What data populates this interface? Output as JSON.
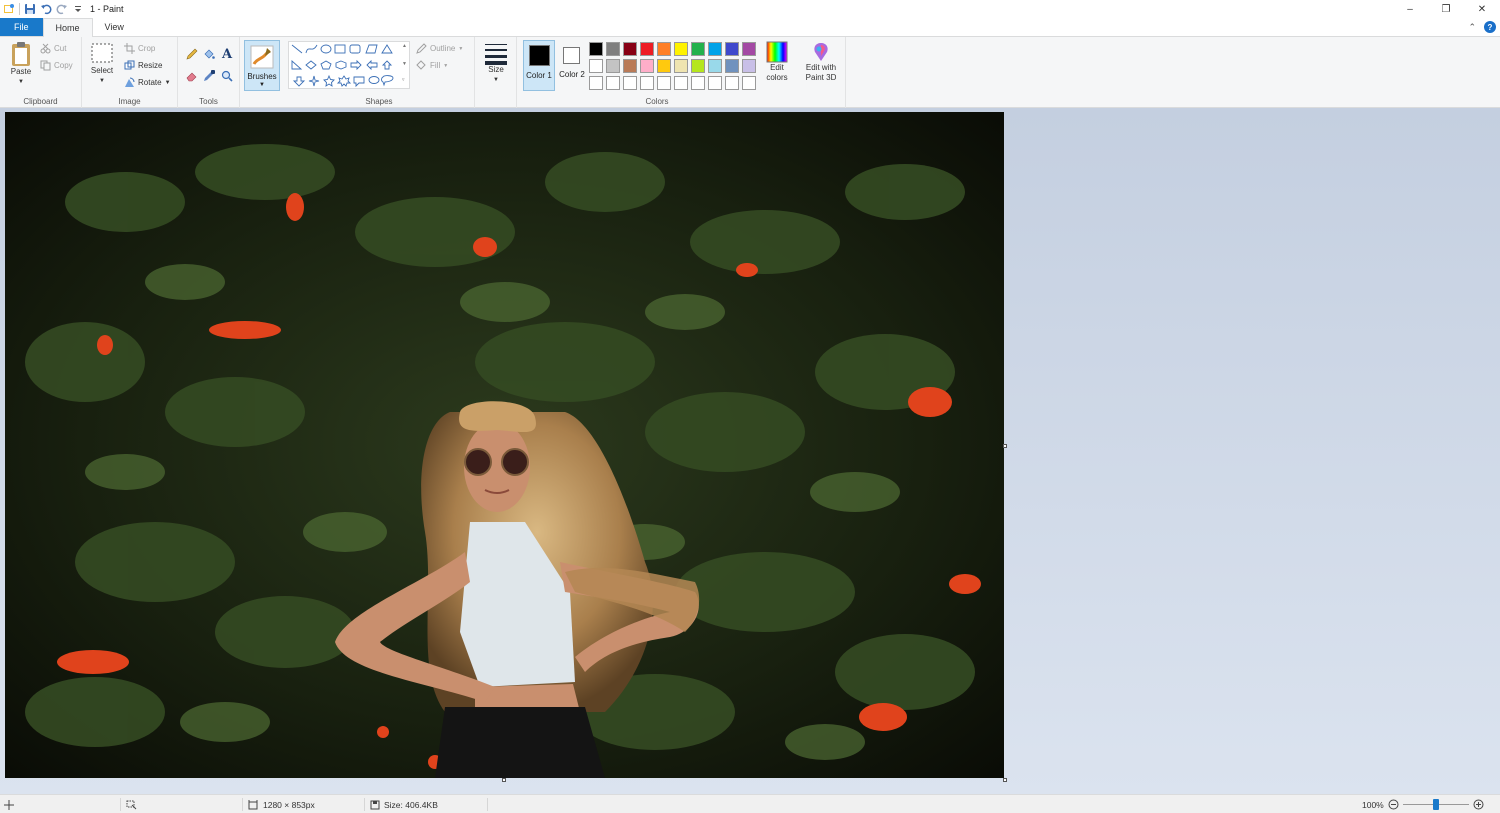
{
  "window": {
    "title": "1 - Paint",
    "controls": [
      "minimize-icon",
      "restore-icon",
      "close-icon"
    ]
  },
  "tabs": [
    {
      "label": "File"
    },
    {
      "label": "Home"
    },
    {
      "label": "View"
    }
  ],
  "ribbon": {
    "clipboard": {
      "label": "Clipboard",
      "paste": "Paste",
      "cut": "Cut",
      "copy": "Copy"
    },
    "image": {
      "label": "Image",
      "select": "Select",
      "crop": "Crop",
      "resize": "Resize",
      "rotate": "Rotate"
    },
    "tools": {
      "label": "Tools"
    },
    "brushes": {
      "label": "Brushes"
    },
    "shapes": {
      "label": "Shapes",
      "outline": "Outline",
      "fill": "Fill"
    },
    "size": {
      "label": "Size"
    },
    "colors": {
      "label": "Colors",
      "color1": "Color 1",
      "color2": "Color 2",
      "edit_colors": "Edit colors",
      "edit_paint3d": "Edit with Paint 3D",
      "palette_row1": [
        "#000000",
        "#7f7f7f",
        "#880015",
        "#ed1c24",
        "#ff7f27",
        "#fff200",
        "#22b14c",
        "#00a2e8",
        "#3f48cc",
        "#a349a4"
      ],
      "palette_row2": [
        "#ffffff",
        "#c3c3c3",
        "#b97a57",
        "#ffaec9",
        "#ffc90e",
        "#efe4b0",
        "#b5e61d",
        "#99d9ea",
        "#7092be",
        "#c8bfe7"
      ],
      "palette_row3": [
        "#ffffff",
        "#ffffff",
        "#ffffff",
        "#ffffff",
        "#ffffff",
        "#ffffff",
        "#ffffff",
        "#ffffff",
        "#ffffff",
        "#ffffff"
      ],
      "primary": "#000000",
      "secondary": "#ffffff"
    }
  },
  "status": {
    "dimensions": "1280 × 853px",
    "size": "Size: 406.4KB",
    "zoom": "100%"
  },
  "accent": "#1979ca"
}
